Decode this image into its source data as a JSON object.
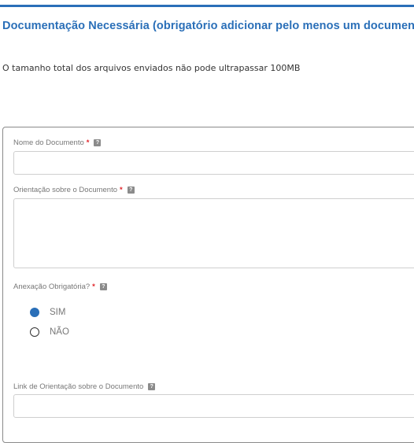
{
  "header": {
    "title": "Documentação Necessária (obrigatório adicionar pelo menos um documento)",
    "size_note": "O tamanho total dos arquivos enviados não pode ultrapassar 100MB"
  },
  "form": {
    "document_name": {
      "label": "Nome do Documento",
      "required_mark": "*",
      "value": ""
    },
    "document_guidance": {
      "label": "Orientação sobre o Documento",
      "required_mark": "*",
      "value": ""
    },
    "mandatory_attachment": {
      "label": "Anexação Obrigatória?",
      "required_mark": "*",
      "options": [
        {
          "label": "SIM",
          "selected": true
        },
        {
          "label": "NÃO",
          "selected": false
        }
      ]
    },
    "guidance_link": {
      "label": "Link de Orientação sobre o Documento",
      "value": ""
    }
  },
  "icons": {
    "help": "help-icon",
    "help_glyph": "?"
  },
  "colors": {
    "accent": "#2a6fb8",
    "required": "#e0252b"
  }
}
